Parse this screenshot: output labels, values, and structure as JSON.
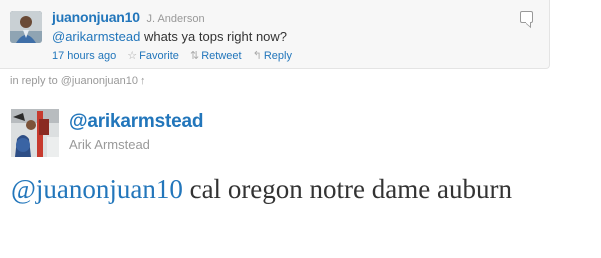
{
  "reply_to_tweet": {
    "screen_name": "juanonjuan10",
    "full_name": "J. Anderson",
    "text_mention": "@arikarmstead",
    "text_body": " whats ya tops right now?",
    "timestamp": "17 hours ago",
    "favorite_label": "Favorite",
    "retweet_label": "Retweet",
    "reply_label": "Reply",
    "favorite_icon": "☆",
    "retweet_icon": "⇅",
    "reply_icon": "↰"
  },
  "in_reply_to": {
    "prefix": "in reply to ",
    "handle": "@juanonjuan10",
    "arrow": "↑"
  },
  "main_tweet": {
    "screen_name": "@arikarmstead",
    "full_name": "Arik Armstead",
    "text_mention": "@juanonjuan10",
    "text_body": " cal oregon notre dame auburn"
  },
  "colors": {
    "link": "#2276bb",
    "muted": "#999999",
    "text": "#333333",
    "card_bg": "#f7f7f7"
  }
}
